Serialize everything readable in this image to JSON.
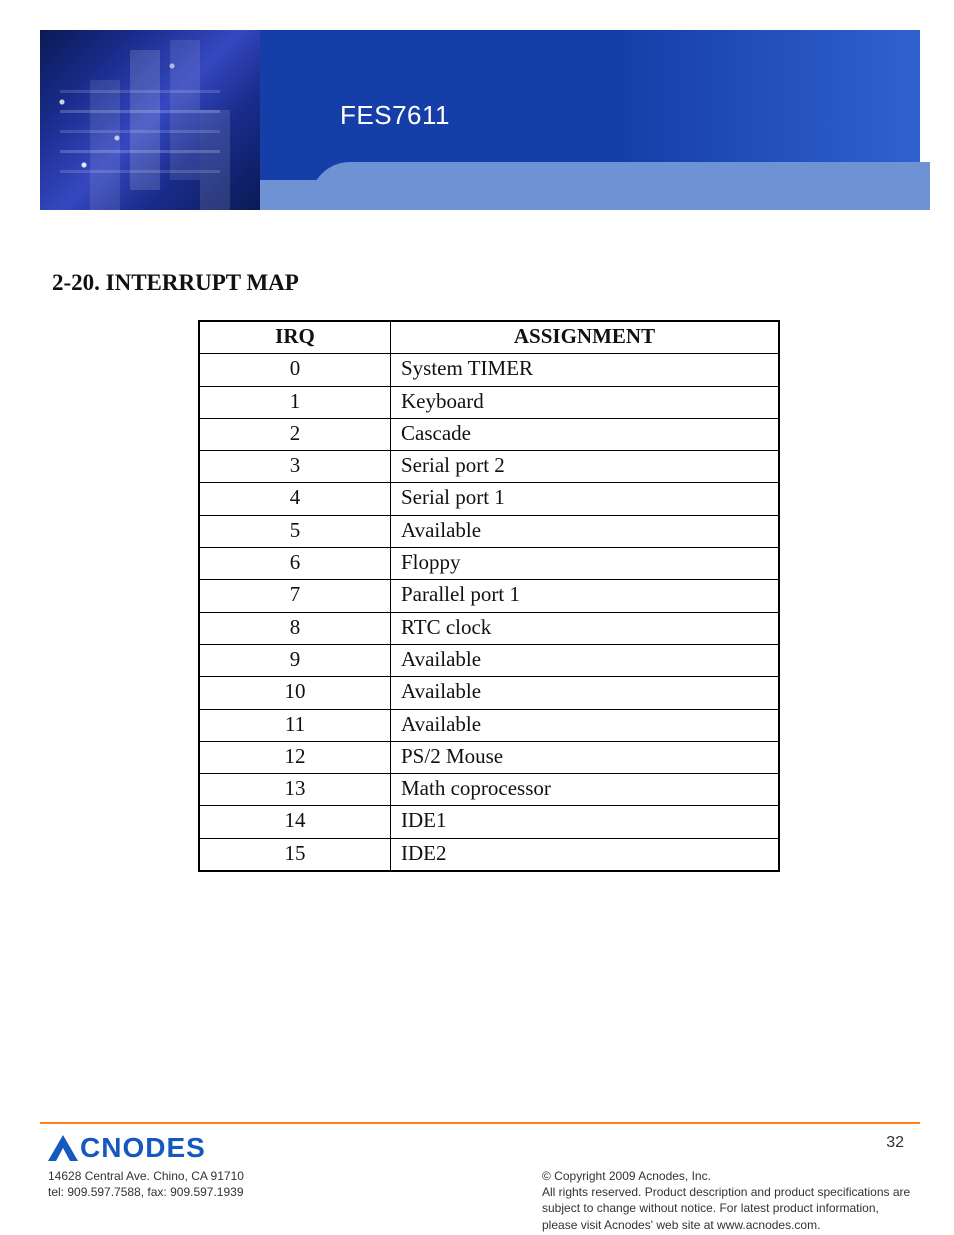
{
  "banner": {
    "product_label": "FES7611"
  },
  "section_title": "2-20. INTERRUPT MAP",
  "table": {
    "headers": {
      "irq": "IRQ",
      "assignment": "ASSIGNMENT"
    },
    "rows": [
      {
        "irq": "0",
        "assignment": "System TIMER"
      },
      {
        "irq": "1",
        "assignment": "Keyboard"
      },
      {
        "irq": "2",
        "assignment": "Cascade"
      },
      {
        "irq": "3",
        "assignment": "Serial port 2"
      },
      {
        "irq": "4",
        "assignment": "Serial port 1"
      },
      {
        "irq": "5",
        "assignment": "Available"
      },
      {
        "irq": "6",
        "assignment": "Floppy"
      },
      {
        "irq": "7",
        "assignment": "Parallel port 1"
      },
      {
        "irq": "8",
        "assignment": "RTC clock"
      },
      {
        "irq": "9",
        "assignment": "Available"
      },
      {
        "irq": "10",
        "assignment": "Available"
      },
      {
        "irq": "11",
        "assignment": "Available"
      },
      {
        "irq": "12",
        "assignment": "PS/2 Mouse"
      },
      {
        "irq": "13",
        "assignment": "Math coprocessor"
      },
      {
        "irq": "14",
        "assignment": "IDE1"
      },
      {
        "irq": "15",
        "assignment": "IDE2"
      }
    ]
  },
  "footer": {
    "logo_text": "CNODES",
    "contact_line1": "14628 Central Ave. Chino, CA 91710",
    "contact_line2": "tel: 909.597.7588, fax: 909.597.1939",
    "copyright_line1": "© Copyright 2009 Acnodes, Inc.",
    "copyright_line2": "All rights reserved. Product description and product specifications are subject to change without notice. For latest product information, please visit Acnodes' web site at www.acnodes.com.",
    "page_number": "32"
  }
}
